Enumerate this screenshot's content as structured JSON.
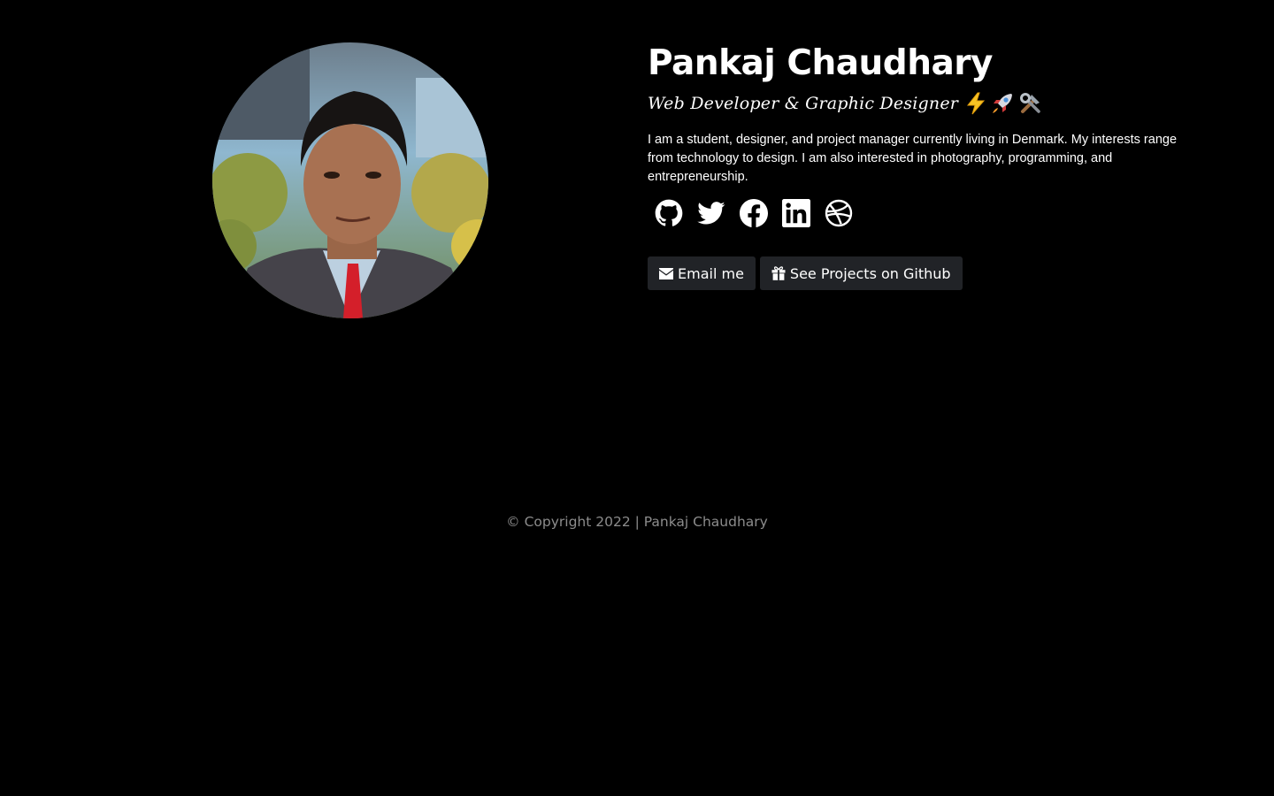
{
  "profile": {
    "name": "Pankaj Chaudhary",
    "tagline": "Web Developer & Graphic Designer",
    "bio": "I am a student, designer, and project manager currently living in Denmark. My interests range from technology to design. I am also interested in photography, programming, and entrepreneurship.",
    "avatar_icon": "profile-photo"
  },
  "tagline_emojis": [
    "lightning-icon",
    "rocket-icon",
    "tools-icon"
  ],
  "socials": [
    {
      "icon": "github-icon"
    },
    {
      "icon": "twitter-icon"
    },
    {
      "icon": "facebook-icon"
    },
    {
      "icon": "linkedin-icon"
    },
    {
      "icon": "dribbble-icon"
    }
  ],
  "actions": {
    "email_label": "Email me",
    "email_icon": "envelope-icon",
    "github_label": "See Projects on Github",
    "github_icon": "gift-icon"
  },
  "footer": {
    "text": "© Copyright 2022 | Pankaj Chaudhary"
  },
  "colors": {
    "background": "#000000",
    "text": "#ffffff",
    "button_bg": "#212327",
    "footer_text": "#8c8c8c"
  }
}
